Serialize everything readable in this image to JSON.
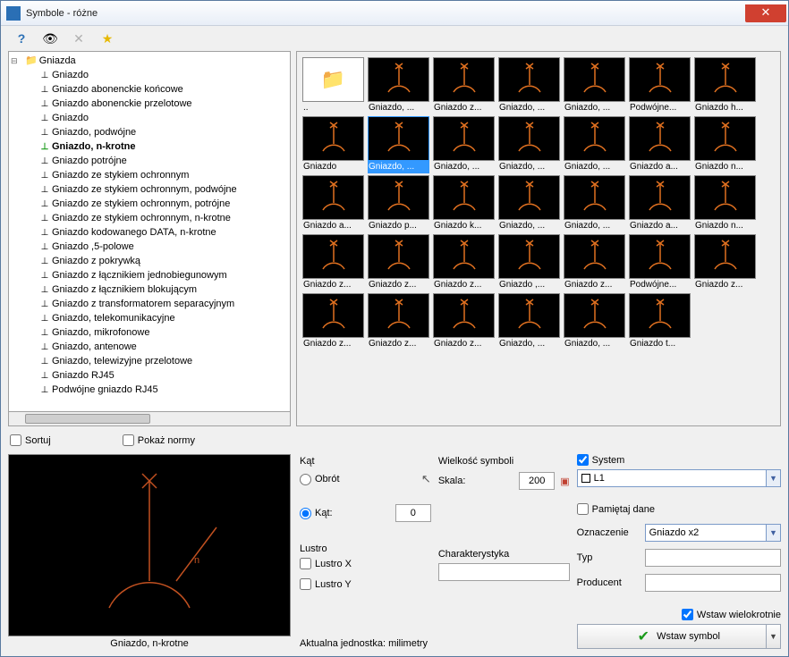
{
  "window": {
    "title": "Symbole - różne"
  },
  "tree": {
    "root": "Gniazda",
    "items": [
      "Gniazdo",
      "Gniazdo abonenckie końcowe",
      "Gniazdo abonenckie przelotowe",
      "Gniazdo",
      "Gniazdo, podwójne",
      "Gniazdo, n-krotne",
      "Gniazdo potrójne",
      "Gniazdo ze stykiem ochronnym",
      "Gniazdo ze stykiem ochronnym, podwójne",
      "Gniazdo ze stykiem ochronnym, potrójne",
      "Gniazdo ze stykiem ochronnym, n-krotne",
      "Gniazdo kodowanego DATA, n-krotne",
      "Gniazdo ,5-polowe",
      "Gniazdo z pokrywką",
      "Gniazdo z łącznikiem jednobiegunowym",
      "Gniazdo z łącznikiem blokującym",
      "Gniazdo z transformatorem separacyjnym",
      "Gniazdo, telekomunikacyjne",
      "Gniazdo, mikrofonowe",
      "Gniazdo, antenowe",
      "Gniazdo, telewizyjne przelotowe",
      "Gniazdo RJ45",
      "Podwójne gniazdo RJ45"
    ],
    "selected_index": 5
  },
  "sort": {
    "sortuj": "Sortuj",
    "pokaz_normy": "Pokaż normy"
  },
  "grid": {
    "rows": [
      [
        {
          "cap": "..",
          "up": true
        },
        {
          "cap": "Gniazdo, ..."
        },
        {
          "cap": "Gniazdo z..."
        },
        {
          "cap": "Gniazdo, ..."
        },
        {
          "cap": "Gniazdo, ..."
        },
        {
          "cap": "Podwójne..."
        },
        {
          "cap": "Gniazdo h..."
        }
      ],
      [
        {
          "cap": "Gniazdo"
        },
        {
          "cap": "Gniazdo, ...",
          "sel": true
        },
        {
          "cap": "Gniazdo, ..."
        },
        {
          "cap": "Gniazdo, ..."
        },
        {
          "cap": "Gniazdo, ..."
        },
        {
          "cap": "Gniazdo a..."
        },
        {
          "cap": "Gniazdo n..."
        }
      ],
      [
        {
          "cap": "Gniazdo a..."
        },
        {
          "cap": "Gniazdo p..."
        },
        {
          "cap": "Gniazdo k..."
        },
        {
          "cap": "Gniazdo, ..."
        },
        {
          "cap": "Gniazdo, ..."
        },
        {
          "cap": "Gniazdo a..."
        },
        {
          "cap": "Gniazdo n..."
        }
      ],
      [
        {
          "cap": "Gniazdo z..."
        },
        {
          "cap": "Gniazdo z..."
        },
        {
          "cap": "Gniazdo z..."
        },
        {
          "cap": "Gniazdo ,..."
        },
        {
          "cap": "Gniazdo z..."
        },
        {
          "cap": "Podwójne..."
        },
        {
          "cap": "Gniazdo z..."
        }
      ],
      [
        {
          "cap": "Gniazdo z..."
        },
        {
          "cap": "Gniazdo z..."
        },
        {
          "cap": "Gniazdo z..."
        },
        {
          "cap": "Gniazdo, ..."
        },
        {
          "cap": "Gniazdo, ..."
        },
        {
          "cap": "Gniazdo t..."
        }
      ]
    ]
  },
  "preview": {
    "caption": "Gniazdo, n-krotne"
  },
  "angle": {
    "group": "Kąt",
    "obrot": "Obrót",
    "kat": "Kąt:",
    "kat_value": "0"
  },
  "mirror": {
    "group": "Lustro",
    "x": "Lustro X",
    "y": "Lustro Y"
  },
  "size": {
    "group": "Wielkość symboli",
    "skala": "Skala:",
    "skala_value": "200"
  },
  "char": {
    "label": "Charakterystyka",
    "value": ""
  },
  "system": {
    "checkbox": "System",
    "value": "L1",
    "remember": "Pamiętaj dane",
    "oznaczenie_lbl": "Oznaczenie",
    "oznaczenie_val": "Gniazdo x2",
    "typ_lbl": "Typ",
    "producent_lbl": "Producent",
    "multi": "Wstaw wielokrotnie",
    "insert": "Wstaw symbol"
  },
  "footer": {
    "units": "Aktualna jednostka: milimetry"
  }
}
